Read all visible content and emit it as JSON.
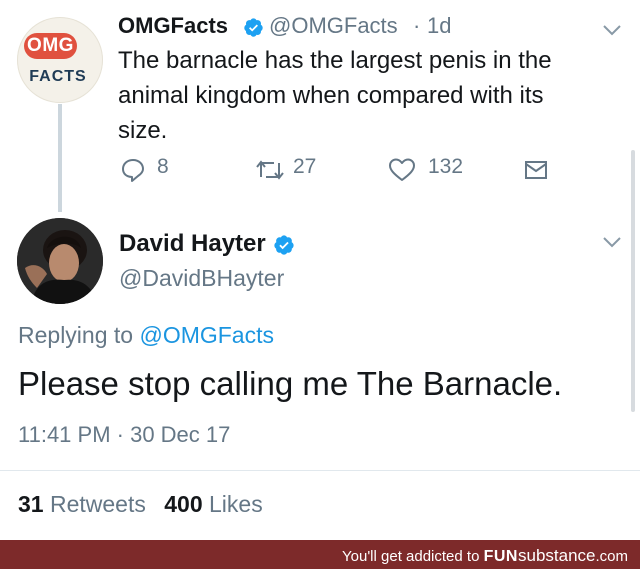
{
  "tweet": {
    "author": {
      "name": "OMGFacts",
      "handle": "@OMGFacts",
      "avatar_text_top": "OMG",
      "avatar_text_bottom": "FACTS"
    },
    "time_separator": "·",
    "time": "1d",
    "text": "The barnacle has the largest penis in the animal kingdom when compared with its size.",
    "actions": {
      "reply_count": "8",
      "retweet_count": "27",
      "like_count": "132"
    }
  },
  "reply": {
    "author": {
      "name": "David Hayter",
      "handle": "@DavidBHayter"
    },
    "replying_prefix": "Replying to",
    "replying_to": "@OMGFacts",
    "text": "Please stop calling me The Barnacle.",
    "timestamp": "11:41 PM · 30 Dec 17",
    "retweets_count": "31",
    "retweets_label": "Retweets",
    "likes_count": "400",
    "likes_label": "Likes"
  },
  "watermark": {
    "prefix": "You'll get addicted to",
    "brand_upper": "FUN",
    "brand_lower": "substance",
    "brand_suffix": ".com"
  },
  "colors": {
    "accent": "#1b95e0",
    "secondary_text": "#657786",
    "omg_red": "#e0513f",
    "footer": "#7d2a2a"
  }
}
